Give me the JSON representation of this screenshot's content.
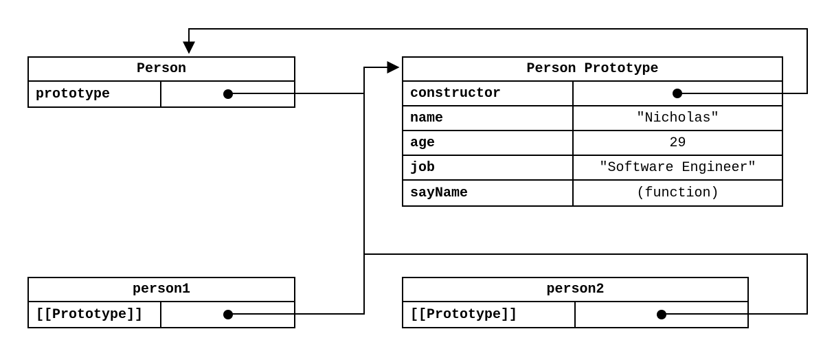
{
  "person_box": {
    "title": "Person",
    "rows": [
      {
        "key": "prototype",
        "value": null,
        "dot": true
      }
    ]
  },
  "proto_box": {
    "title": "Person Prototype",
    "rows": [
      {
        "key": "constructor",
        "value": null,
        "dot": true
      },
      {
        "key": "name",
        "value": "\"Nicholas\""
      },
      {
        "key": "age",
        "value": "29"
      },
      {
        "key": "job",
        "value": "\"Software Engineer\""
      },
      {
        "key": "sayName",
        "value": "(function)"
      }
    ]
  },
  "person1_box": {
    "title": "person1",
    "rows": [
      {
        "key": "[[Prototype]]",
        "value": null,
        "dot": true
      }
    ]
  },
  "person2_box": {
    "title": "person2",
    "rows": [
      {
        "key": "[[Prototype]]",
        "value": null,
        "dot": true
      }
    ]
  }
}
